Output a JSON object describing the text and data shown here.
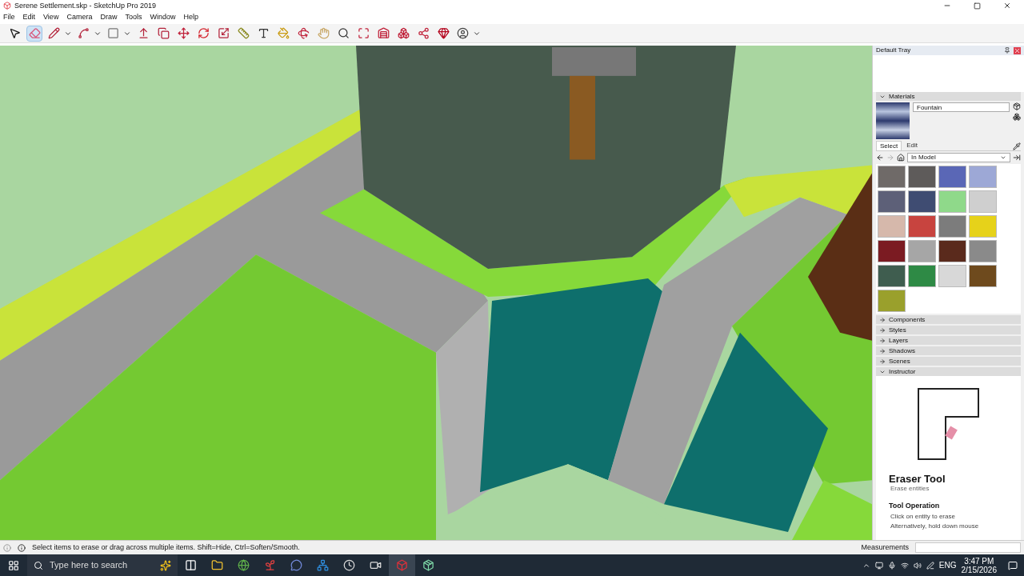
{
  "window": {
    "title": "Serene Settlement.skp - SketchUp Pro 2019"
  },
  "menu": [
    "File",
    "Edit",
    "View",
    "Camera",
    "Draw",
    "Tools",
    "Window",
    "Help"
  ],
  "toolbar": [
    {
      "kind": "select",
      "selected": false,
      "has_menu": false
    },
    {
      "kind": "eraser",
      "selected": true,
      "has_menu": false
    },
    {
      "kind": "pencil",
      "selected": false,
      "has_menu": true
    },
    {
      "kind": "arc",
      "selected": false,
      "has_menu": true
    },
    {
      "kind": "rectangle",
      "selected": false,
      "has_menu": true
    },
    {
      "kind": "pushpull",
      "selected": false,
      "has_menu": false
    },
    {
      "kind": "offset",
      "selected": false,
      "has_menu": false
    },
    {
      "kind": "move",
      "selected": false,
      "has_menu": false
    },
    {
      "kind": "rotate",
      "selected": false,
      "has_menu": false
    },
    {
      "kind": "scale",
      "selected": false,
      "has_menu": false
    },
    {
      "kind": "tape",
      "selected": false,
      "has_menu": false
    },
    {
      "kind": "text",
      "selected": false,
      "has_menu": false
    },
    {
      "kind": "paint",
      "selected": false,
      "has_menu": false
    },
    {
      "kind": "orbit",
      "selected": false,
      "has_menu": false
    },
    {
      "kind": "pan",
      "selected": false,
      "has_menu": false
    },
    {
      "kind": "zoom",
      "selected": false,
      "has_menu": false
    },
    {
      "kind": "extents",
      "selected": false,
      "has_menu": false
    },
    {
      "kind": "warehouse",
      "selected": false,
      "has_menu": false
    },
    {
      "kind": "components",
      "selected": false,
      "has_menu": false
    },
    {
      "kind": "share",
      "selected": false,
      "has_menu": false
    },
    {
      "kind": "ruby",
      "selected": false,
      "has_menu": false
    },
    {
      "kind": "account",
      "selected": false,
      "has_menu": true
    }
  ],
  "tray": {
    "title": "Default Tray",
    "materials": {
      "title": "Materials",
      "name": "Fountain",
      "tabs": [
        {
          "label": "Select",
          "selected": true
        },
        {
          "label": "Edit",
          "selected": false
        }
      ],
      "library": "In Model",
      "swatches": [
        {
          "color": "#6f6a68"
        },
        {
          "color": "#5e5b5a"
        },
        {
          "color": "#5a67b6"
        },
        {
          "color": "#9da8d6"
        },
        {
          "color": "#5d6078"
        },
        {
          "color": "#3f4c72"
        },
        {
          "color": "#8fd98a"
        },
        {
          "color": "#cfcfcf"
        },
        {
          "color": "#d6b8ab"
        },
        {
          "color": "#c8443f"
        },
        {
          "color": "#7c7c7c"
        },
        {
          "color": "#e6d21a"
        },
        {
          "color": "#7b1b22"
        },
        {
          "color": "#a6a6a6"
        },
        {
          "color": "#5a2a1c"
        },
        {
          "color": "#8a8a8a"
        },
        {
          "color": "#3f5d4f"
        },
        {
          "color": "#2e8a45"
        },
        {
          "color": "#d8d8d8"
        },
        {
          "color": "#6e4a1d"
        },
        {
          "color": "#9aa02c"
        }
      ]
    },
    "panels": [
      {
        "title": "Components",
        "expanded": false
      },
      {
        "title": "Styles",
        "expanded": false
      },
      {
        "title": "Layers",
        "expanded": false
      },
      {
        "title": "Shadows",
        "expanded": false
      },
      {
        "title": "Scenes",
        "expanded": false
      },
      {
        "title": "Instructor",
        "expanded": true
      }
    ],
    "instructor": {
      "tool": "Eraser Tool",
      "summary": "Erase entities",
      "heading": "Tool Operation",
      "lines": [
        "Click on entity to erase",
        "Alternatively, hold down mouse"
      ]
    }
  },
  "status_bar": {
    "hint": "Select items to erase or drag across multiple items. Shift=Hide, Ctrl=Soften/Smooth.",
    "measurements_label": "Measurements"
  },
  "taskbar": {
    "search_placeholder": "Type here to search",
    "apps": [
      {
        "kind": "taskview",
        "selected": false
      },
      {
        "kind": "explorer",
        "selected": false
      },
      {
        "kind": "browser",
        "selected": false
      },
      {
        "kind": "mushroom",
        "selected": false
      },
      {
        "kind": "chat",
        "selected": false
      },
      {
        "kind": "network",
        "selected": false
      },
      {
        "kind": "clock",
        "selected": false
      },
      {
        "kind": "recorder",
        "selected": false
      },
      {
        "kind": "sketchup",
        "selected": true
      },
      {
        "kind": "cube",
        "selected": false
      }
    ],
    "language": "ENG",
    "time": "3:47 PM",
    "date": "2/15/2026"
  }
}
